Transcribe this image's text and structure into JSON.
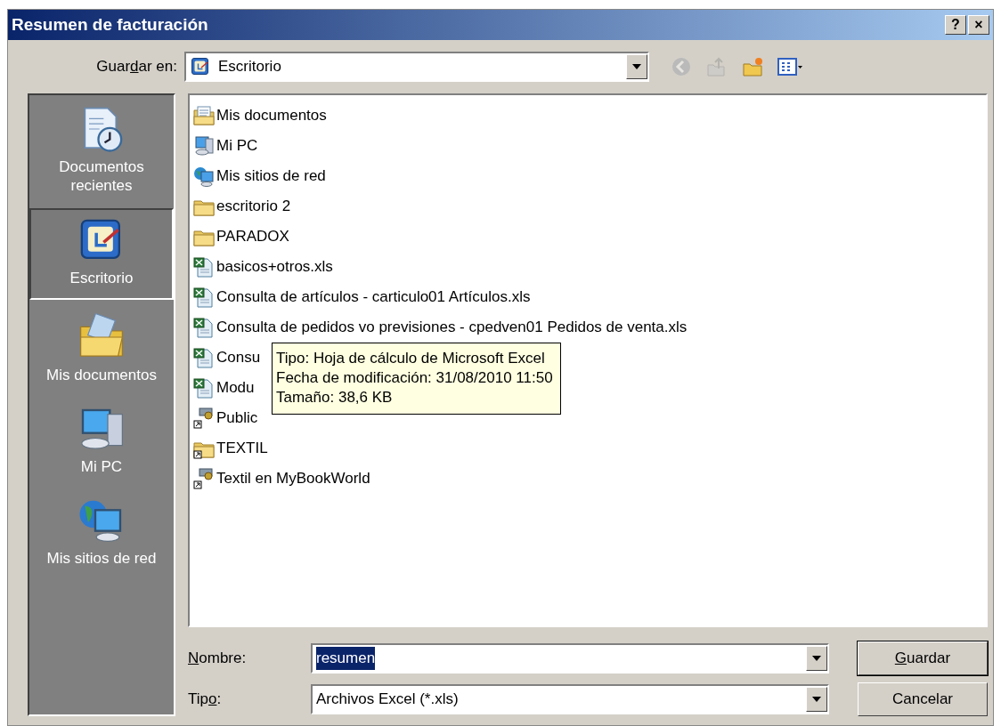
{
  "window": {
    "title": "Resumen de facturación",
    "buttons": [
      {
        "label": "?"
      },
      {
        "label": "×"
      }
    ]
  },
  "save_in": {
    "label": {
      "before": "Guar",
      "key": "d",
      "after": "ar en:"
    },
    "value": "Escritorio"
  },
  "toolbar": [
    {
      "kind": "back",
      "disabled": true
    },
    {
      "kind": "up",
      "disabled": true
    },
    {
      "kind": "new-folder",
      "disabled": false
    },
    {
      "kind": "views",
      "disabled": false
    }
  ],
  "places": [
    {
      "kind": "recent",
      "label": "Documentos recientes",
      "selected": false
    },
    {
      "kind": "desktop",
      "label": "Escritorio",
      "selected": true
    },
    {
      "kind": "mydocs",
      "label": "Mis documentos",
      "selected": false
    },
    {
      "kind": "pc",
      "label": "Mi PC",
      "selected": false
    },
    {
      "kind": "network",
      "label": "Mis sitios de red",
      "selected": false
    }
  ],
  "files": [
    {
      "kind": "mydocs",
      "name": "Mis documentos"
    },
    {
      "kind": "pc",
      "name": "Mi PC"
    },
    {
      "kind": "network",
      "name": "Mis sitios de red"
    },
    {
      "kind": "folder",
      "name": "escritorio 2"
    },
    {
      "kind": "folder",
      "name": "PARADOX"
    },
    {
      "kind": "excel",
      "name": "basicos+otros.xls"
    },
    {
      "kind": "excel",
      "name": "Consulta de artículos - carticulo01 Artículos.xls"
    },
    {
      "kind": "excel",
      "name": "Consulta de pedidos vo previsiones - cpedven01 Pedidos de venta.xls"
    },
    {
      "kind": "excel",
      "name": "Consu"
    },
    {
      "kind": "excel",
      "name": "Modu"
    },
    {
      "kind": "share",
      "name": "Public"
    },
    {
      "kind": "folder-link",
      "name": "TEXTIL"
    },
    {
      "kind": "share",
      "name": "Textil en MyBookWorld"
    }
  ],
  "tooltip": {
    "lines": [
      "Tipo: Hoja de cálculo de Microsoft Excel",
      "Fecha de modificación: 31/08/2010 11:50",
      "Tamaño: 38,6 KB"
    ]
  },
  "file_name": {
    "label": {
      "key": "N",
      "after": "ombre:"
    },
    "value": "resumen",
    "selected": true
  },
  "file_type": {
    "label": {
      "before": "Tip",
      "key": "o",
      "after": ":"
    },
    "value": "Archivos Excel (*.xls)"
  },
  "buttons": [
    {
      "label": {
        "key": "G",
        "after": "uardar"
      },
      "default": true
    },
    {
      "label": {
        "before": "Cancelar"
      },
      "default": false
    }
  ]
}
